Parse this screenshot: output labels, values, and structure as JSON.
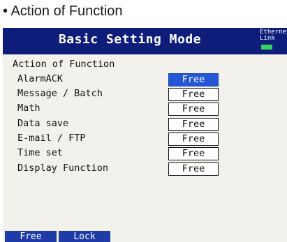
{
  "caption": "• Action of Function",
  "header": {
    "title": "Basic Setting Mode",
    "ethernet_label": "Ethernet",
    "link_label": "Link"
  },
  "section_heading": "Action of Function",
  "rows": [
    {
      "label": "AlarmACK",
      "value": "Free",
      "selected": true
    },
    {
      "label": "Message / Batch",
      "value": "Free"
    },
    {
      "label": "Math",
      "value": "Free"
    },
    {
      "label": "Data save",
      "value": "Free"
    },
    {
      "label": "E-mail / FTP",
      "value": "Free"
    },
    {
      "label": "Time set",
      "value": "Free"
    },
    {
      "label": "Display Function",
      "value": "Free"
    }
  ],
  "softkeys": [
    "Free",
    "Lock"
  ],
  "colors": {
    "title_bar": "#0f1d7a",
    "selected_value": "#2456d8",
    "softkey": "#1f3ba8",
    "link_indicator": "#2fd65a",
    "screen_background": "#f2f1ec"
  }
}
